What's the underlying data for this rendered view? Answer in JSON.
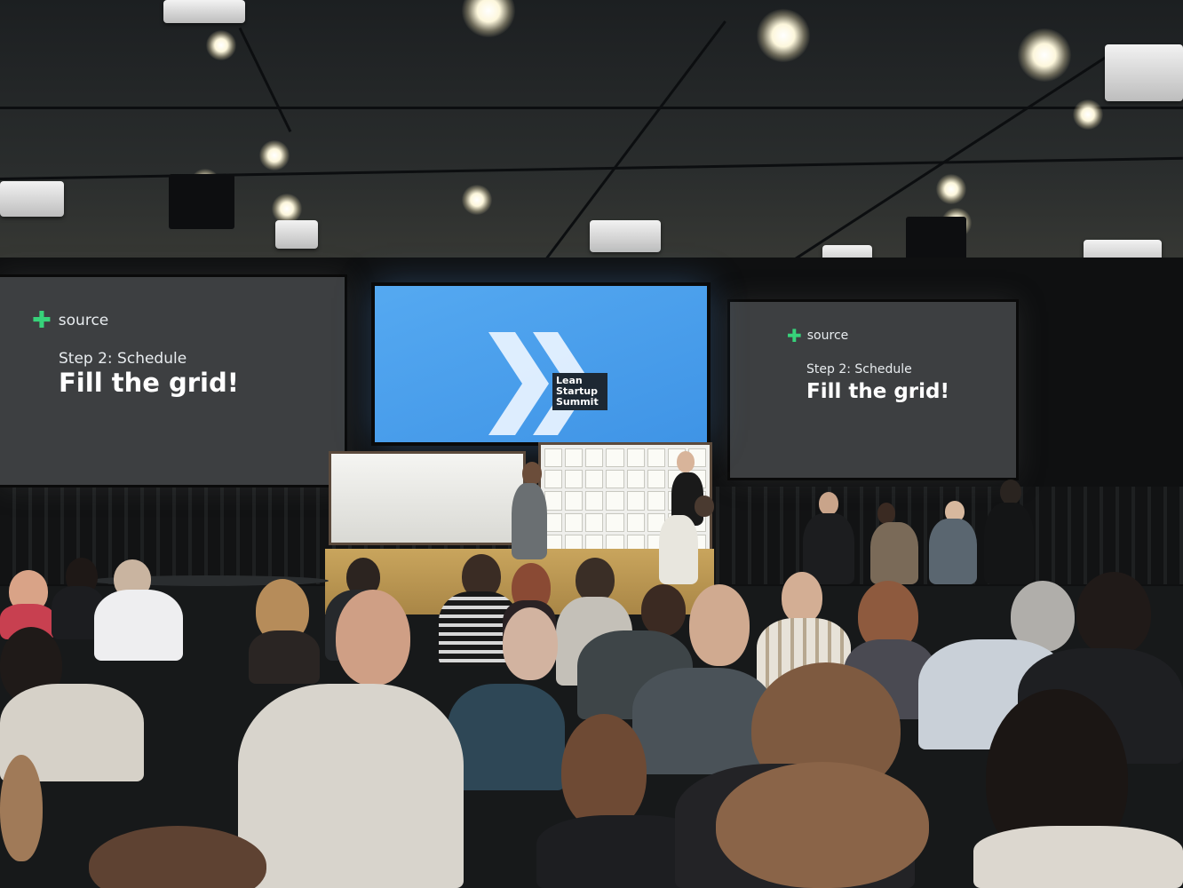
{
  "scene": {
    "side_screens": [
      {
        "brand": "source",
        "step": "Step 2: Schedule",
        "headline": "Fill the grid!"
      },
      {
        "brand": "source",
        "step": "Step 2: Schedule",
        "headline": "Fill the grid!"
      }
    ],
    "center_screen": {
      "logo_text": [
        "Lean",
        "Startup",
        "Summit"
      ]
    },
    "colors": {
      "accent_green": "#37d27a",
      "center_screen_blue": "#4a9eeb",
      "side_screen_gray": "#3d3f41"
    }
  }
}
